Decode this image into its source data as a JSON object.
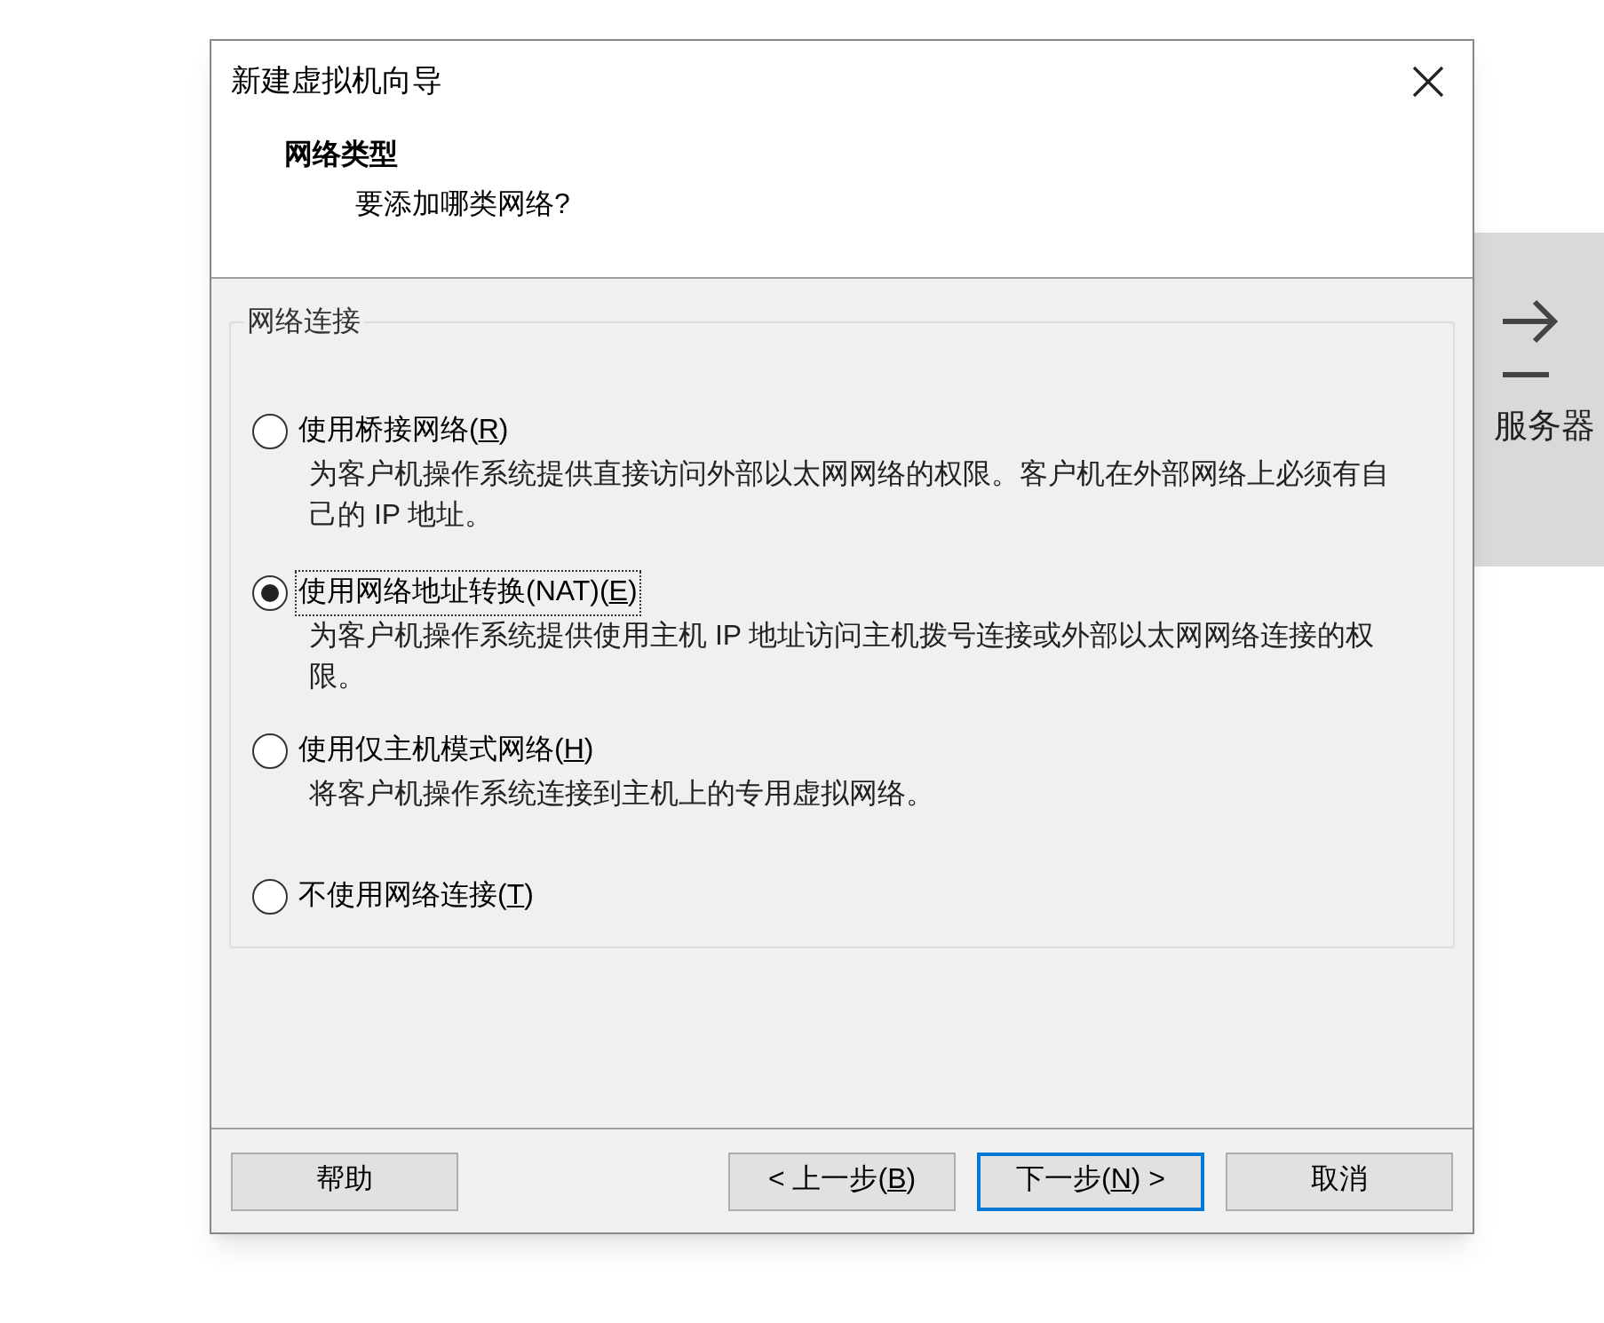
{
  "background_panel": {
    "label": "服务器"
  },
  "window": {
    "title": "新建虚拟机向导"
  },
  "header": {
    "title": "网络类型",
    "subtitle": "要添加哪类网络?"
  },
  "group": {
    "title": "网络连接"
  },
  "options": [
    {
      "label_before": "使用桥接网络(",
      "access_key": "R",
      "label_after": ")",
      "description": "为客户机操作系统提供直接访问外部以太网网络的权限。客户机在外部网络上必须有自己的 IP 地址。",
      "selected": false
    },
    {
      "label_before": "使用网络地址转换(NAT)(",
      "access_key": "E",
      "label_after": ")",
      "description": "为客户机操作系统提供使用主机 IP 地址访问主机拨号连接或外部以太网网络连接的权限。",
      "selected": true
    },
    {
      "label_before": "使用仅主机模式网络(",
      "access_key": "H",
      "label_after": ")",
      "description": "将客户机操作系统连接到主机上的专用虚拟网络。",
      "selected": false
    },
    {
      "label_before": "不使用网络连接(",
      "access_key": "T",
      "label_after": ")",
      "selected": false
    }
  ],
  "buttons": [
    {
      "label_before": "帮助",
      "default": false
    },
    {
      "label_before": "< 上一步(",
      "access_key": "B",
      "label_after": ")",
      "default": false
    },
    {
      "label_before": "下一步(",
      "access_key": "N",
      "label_after": ") >",
      "default": true
    },
    {
      "label_before": "取消",
      "default": false
    }
  ]
}
